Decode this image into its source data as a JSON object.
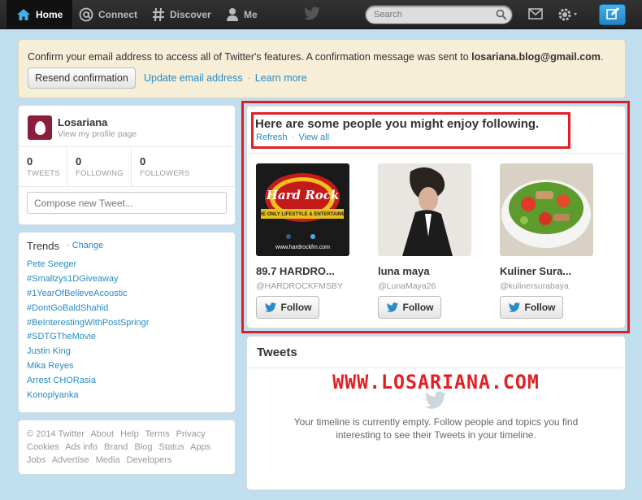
{
  "nav": {
    "home": "Home",
    "connect": "Connect",
    "discover": "Discover",
    "me": "Me",
    "search_placeholder": "Search"
  },
  "confirm": {
    "message": "Confirm your email address to access all of Twitter's features. A confirmation message was sent to ",
    "email": "losariana.blog@gmail.com",
    "suffix": ".",
    "resend_label": "Resend confirmation",
    "update_link": "Update email address",
    "dot": "·",
    "learn_more": "Learn more"
  },
  "profile": {
    "name": "Losariana",
    "sub": "View my profile page",
    "stats": [
      {
        "num": "0",
        "label": "TWEETS"
      },
      {
        "num": "0",
        "label": "FOLLOWING"
      },
      {
        "num": "0",
        "label": "FOLLOWERS"
      }
    ],
    "compose_placeholder": "Compose new Tweet..."
  },
  "trends": {
    "title": "Trends",
    "change": "· Change",
    "items": [
      "Pete Seeger",
      "#Smallzys1DGiveaway",
      "#1YearOfBelieveAcoustic",
      "#DontGoBaldShahid",
      "#BeInterestingWithPostSpringr",
      "#SDTGTheMovie",
      "Justin King",
      "Mika Reyes",
      "Arrest CHORasia",
      "Konoplyanka"
    ]
  },
  "footer": {
    "links": [
      "© 2014 Twitter",
      "About",
      "Help",
      "Terms",
      "Privacy",
      "Cookies",
      "Ads info",
      "Brand",
      "Blog",
      "Status",
      "Apps",
      "Jobs",
      "Advertise",
      "Media",
      "Developers"
    ]
  },
  "who_to_follow": {
    "title": "Here are some people you might enjoy following.",
    "refresh": "Refresh",
    "dot": "·",
    "view_all": "View all",
    "follow_label": "Follow",
    "suggestions": [
      {
        "name": "89.7 HARDRO...",
        "handle": "@HARDROCKFMSBY",
        "image": "hard-rock-logo",
        "logo_text": "Hard Rock",
        "banner": "THE ONLY LIFESTYLE & ENTERTAINMENT STATION",
        "site": "www.hardrockfm.com"
      },
      {
        "name": "luna maya",
        "handle": "@LunaMaya26",
        "image": "woman-portrait"
      },
      {
        "name": "Kuliner Sura...",
        "handle": "@kulinersurabaya",
        "image": "salad-bowl"
      }
    ]
  },
  "tweets": {
    "title": "Tweets",
    "watermark": "WWW.LOSARIANA.COM",
    "empty": "Your timeline is currently empty. Follow people and topics you find interesting to see their Tweets in your timeline."
  },
  "colors": {
    "accent": "#2a8ac4",
    "highlight_red": "#e11f26",
    "background": "#c0deed"
  }
}
